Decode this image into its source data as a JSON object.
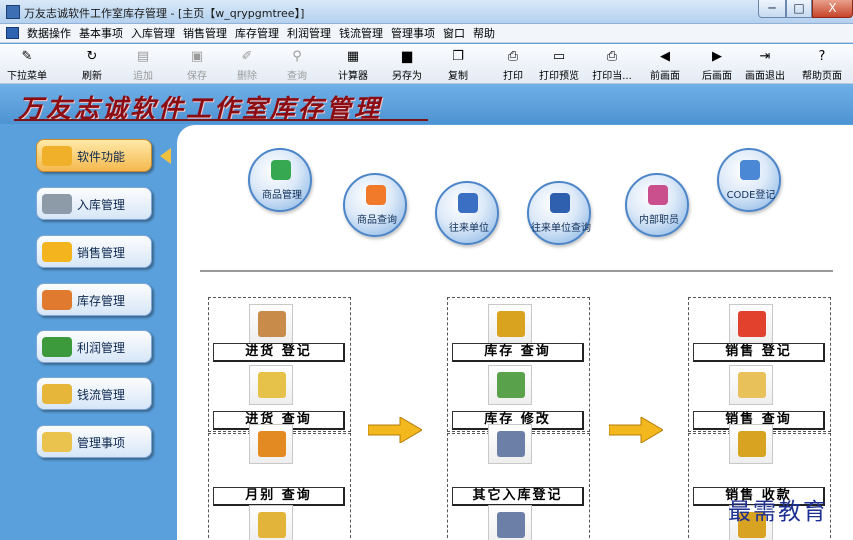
{
  "window": {
    "title": "万友志诚软件工作室库存管理 - [主页【w_qrypgmtree】]",
    "min_label": "─",
    "max_label": "□",
    "close_label": "X"
  },
  "menu": [
    "数据操作",
    "基本事项",
    "入库管理",
    "销售管理",
    "库存管理",
    "利润管理",
    "钱流管理",
    "管理事项",
    "窗口",
    "帮助"
  ],
  "toolbar": [
    {
      "label": "下拉菜单",
      "icon": "dropdown-menu-icon",
      "glyph": "✎",
      "enabled": true
    },
    {
      "label": "刷新",
      "icon": "refresh-icon",
      "glyph": "↻",
      "enabled": true
    },
    {
      "label": "追加",
      "icon": "add-icon",
      "glyph": "▤",
      "enabled": false
    },
    {
      "label": "保存",
      "icon": "save-icon",
      "glyph": "▣",
      "enabled": false
    },
    {
      "label": "删除",
      "icon": "delete-icon",
      "glyph": "✐",
      "enabled": false
    },
    {
      "label": "查询",
      "icon": "query-icon",
      "glyph": "⚲",
      "enabled": false
    },
    {
      "label": "计算器",
      "icon": "calculator-icon",
      "glyph": "▦",
      "enabled": true
    },
    {
      "label": "另存为",
      "icon": "save-as-icon",
      "glyph": "▆",
      "enabled": true
    },
    {
      "label": "复制",
      "icon": "copy-icon",
      "glyph": "❐",
      "enabled": true
    },
    {
      "label": "打印",
      "icon": "print-icon",
      "glyph": "⎙",
      "enabled": true
    },
    {
      "label": "打印预览",
      "icon": "print-preview-icon",
      "glyph": "▭",
      "enabled": true
    },
    {
      "label": "打印当...",
      "icon": "print-current-icon",
      "glyph": "⎙",
      "enabled": true
    },
    {
      "label": "前画面",
      "icon": "prev-screen-icon",
      "glyph": "◀",
      "enabled": true
    },
    {
      "label": "后画面",
      "icon": "next-screen-icon",
      "glyph": "▶",
      "enabled": true
    },
    {
      "label": "画面退出",
      "icon": "exit-screen-icon",
      "glyph": "⇥",
      "enabled": true
    },
    {
      "label": "帮助页面",
      "icon": "help-icon",
      "glyph": "?",
      "enabled": true
    }
  ],
  "banner": {
    "title": "万友志诚软件工作室库存管理"
  },
  "sidebar": [
    {
      "label": "软件功能",
      "icon": "software-function-icon",
      "active": true,
      "color": "#f0b02a"
    },
    {
      "label": "入库管理",
      "icon": "truck-icon",
      "active": false,
      "color": "#8d9aa8"
    },
    {
      "label": "销售管理",
      "icon": "sales-icon",
      "active": false,
      "color": "#f3b41e"
    },
    {
      "label": "库存管理",
      "icon": "warehouse-icon",
      "active": false,
      "color": "#e07a2f"
    },
    {
      "label": "利润管理",
      "icon": "pie-chart-icon",
      "active": false,
      "color": "#3c9a3c"
    },
    {
      "label": "钱流管理",
      "icon": "money-flow-icon",
      "active": false,
      "color": "#e5b63a"
    },
    {
      "label": "管理事项",
      "icon": "admin-box-icon",
      "active": false,
      "color": "#e9c34d"
    }
  ],
  "circles": [
    {
      "label": "商品管理",
      "icon": "product-cubes-icon",
      "color": "#36a852"
    },
    {
      "label": "商品查询",
      "icon": "product-shield-icon",
      "color": "#f07a2a"
    },
    {
      "label": "往来单位",
      "icon": "partner-group-icon",
      "color": "#3a6fc4"
    },
    {
      "label": "往来单位查询",
      "icon": "partner-query-icon",
      "color": "#2f60b0"
    },
    {
      "label": "内部职员",
      "icon": "staff-group-icon",
      "color": "#c9508c"
    },
    {
      "label": "CODE登记",
      "icon": "code-user-icon",
      "color": "#4a88d6"
    }
  ],
  "function_buttons": [
    {
      "label": "进货 登记",
      "icon": "purchase-box-icon",
      "color": "#c88b4a"
    },
    {
      "label": "进货 查询",
      "icon": "purchase-query-icon",
      "color": "#e6c24a"
    },
    {
      "label": "月别 查询",
      "icon": "monthly-query-icon",
      "color": "#e48a22"
    },
    {
      "label": "库存 查询",
      "icon": "forklift-icon",
      "color": "#d9a21f"
    },
    {
      "label": "库存 修改",
      "icon": "stock-edit-icon",
      "color": "#5aa14c"
    },
    {
      "label": "其它入库登记",
      "icon": "other-inbound-icon",
      "color": "#6b7fa7"
    },
    {
      "label": "销售 登记",
      "icon": "cart-icon",
      "color": "#e2412e"
    },
    {
      "label": "销售 查询",
      "icon": "sales-query-icon",
      "color": "#e9c15a"
    },
    {
      "label": "销售 收款",
      "icon": "coins-icon",
      "color": "#d7a320"
    }
  ],
  "watermark": "最需教育"
}
